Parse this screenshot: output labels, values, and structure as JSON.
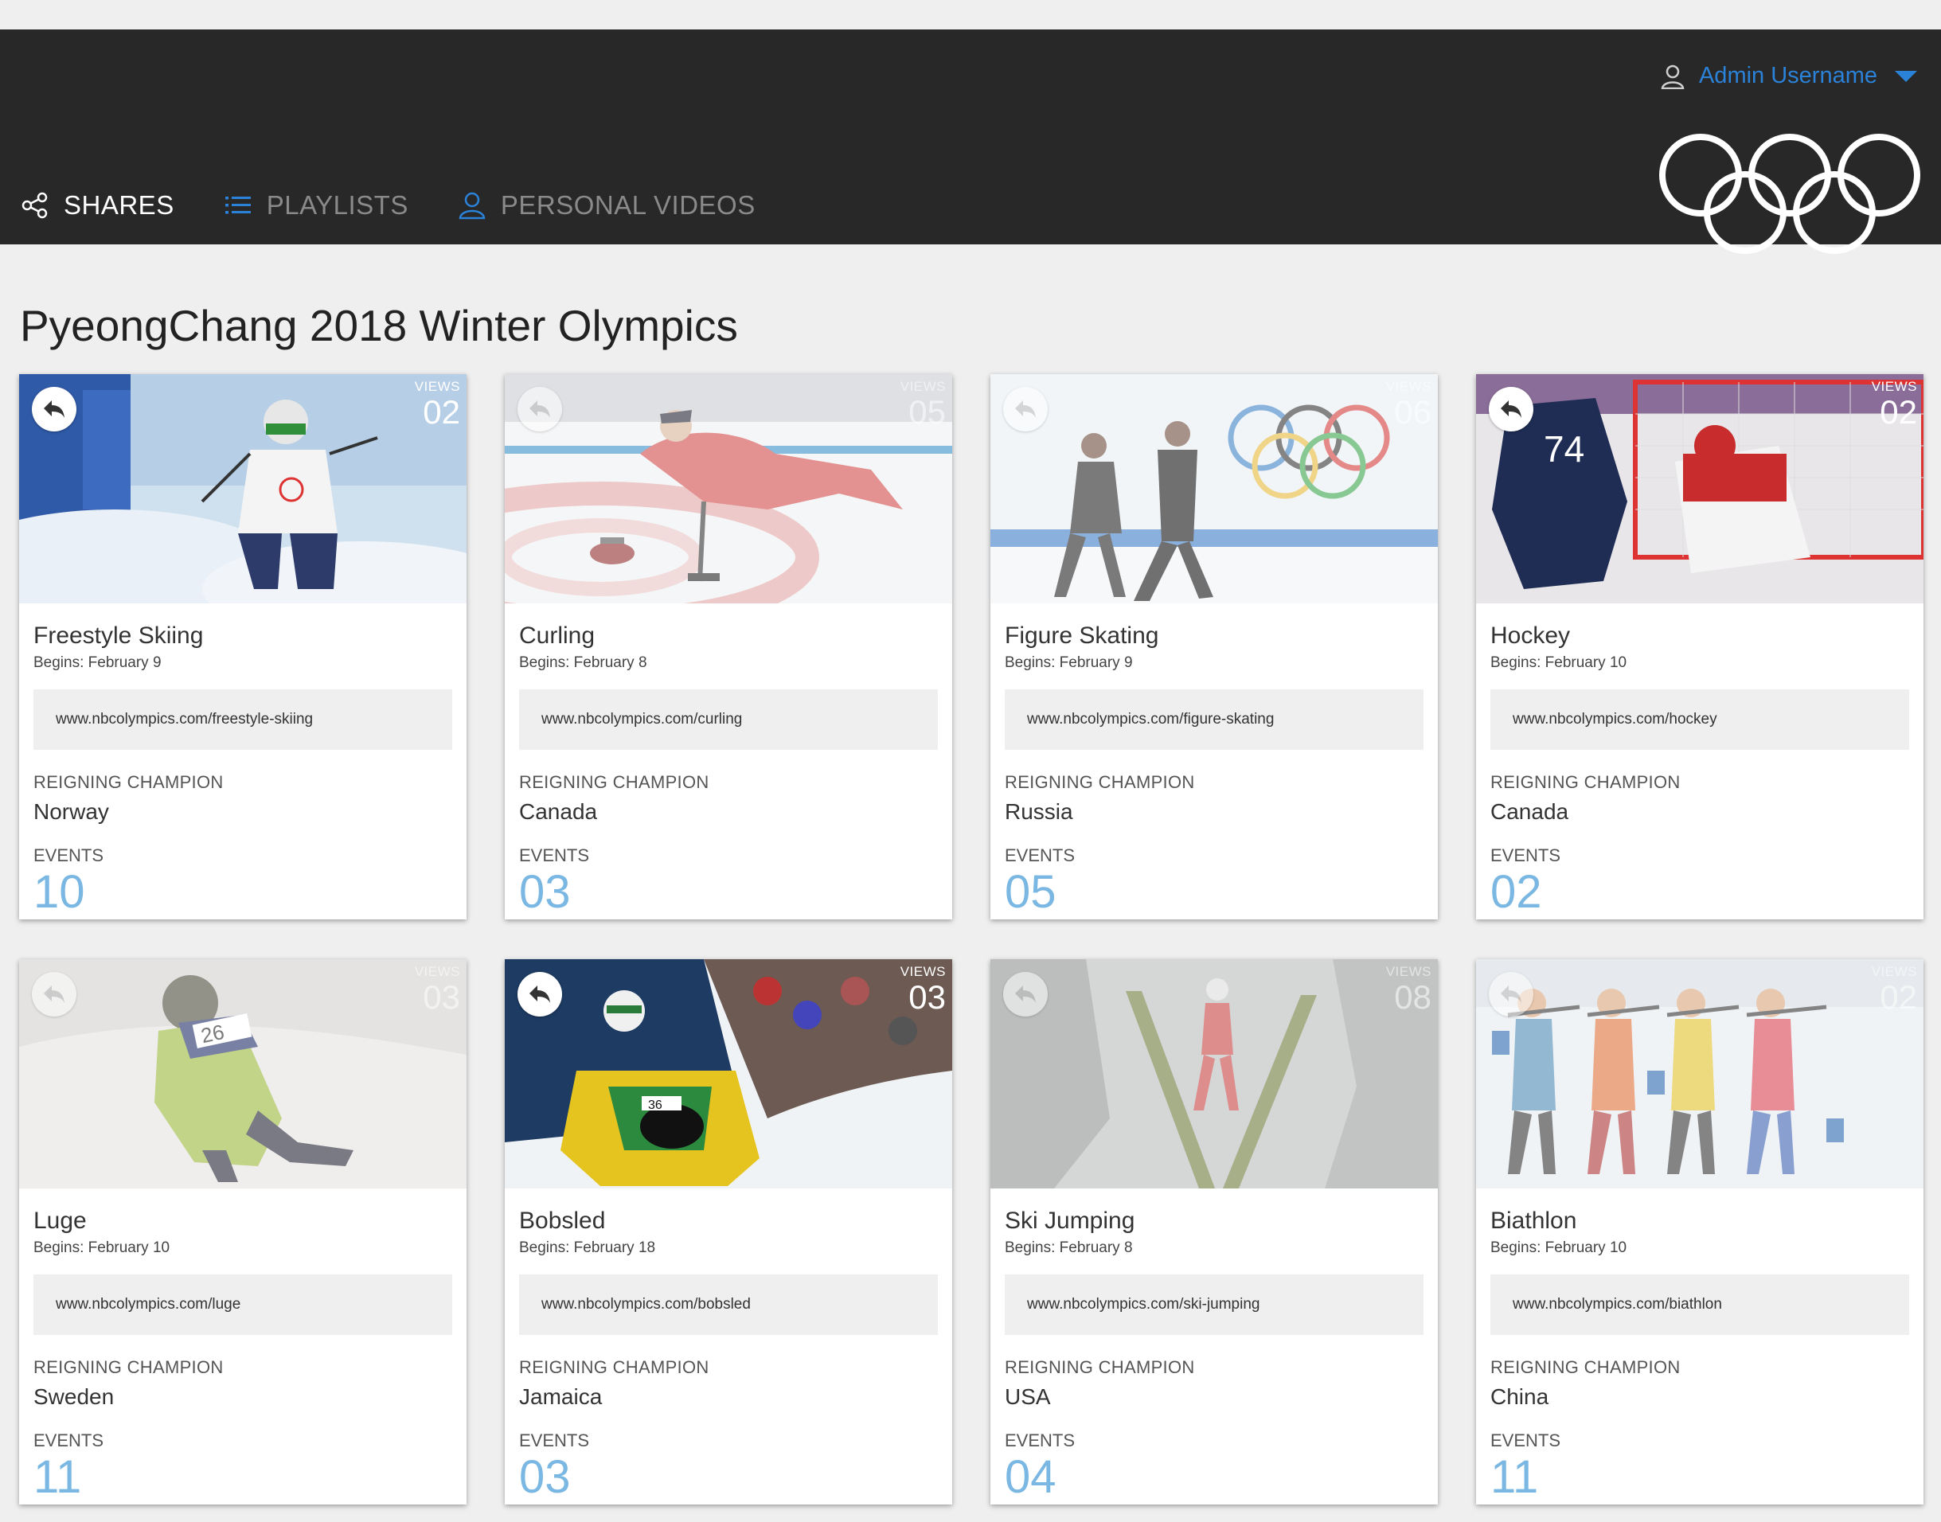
{
  "header": {
    "user_label": "Admin Username",
    "user_icon": "user-icon",
    "nav": [
      {
        "label": "SHARES",
        "icon": "share-icon",
        "active": true
      },
      {
        "label": "PLAYLISTS",
        "icon": "list-icon",
        "active": false
      },
      {
        "label": "PERSONAL VIDEOS",
        "icon": "user-icon",
        "active": false
      }
    ],
    "accent_color": "#2b82d9"
  },
  "page": {
    "title": "PyeongChang 2018 Winter Olympics"
  },
  "labels": {
    "views": "VIEWS",
    "champion": "REIGNING CHAMPION",
    "events": "EVENTS"
  },
  "cards": [
    {
      "sport": "Freestyle Skiing",
      "begins": "Begins: February 9",
      "url": "www.nbcolympics.com/freestyle-skiing",
      "champion": "Norway",
      "events": "10",
      "views": "02"
    },
    {
      "sport": "Curling",
      "begins": "Begins: February 8",
      "url": "www.nbcolympics.com/curling",
      "champion": "Canada",
      "events": "03",
      "views": "05"
    },
    {
      "sport": "Figure Skating",
      "begins": "Begins: February 9",
      "url": "www.nbcolympics.com/figure-skating",
      "champion": "Russia",
      "events": "05",
      "views": "06"
    },
    {
      "sport": "Hockey",
      "begins": "Begins: February 10",
      "url": "www.nbcolympics.com/hockey",
      "champion": "Canada",
      "events": "02",
      "views": "02"
    },
    {
      "sport": "Luge",
      "begins": "Begins: February 10",
      "url": "www.nbcolympics.com/luge",
      "champion": "Sweden",
      "events": "11",
      "views": "03"
    },
    {
      "sport": "Bobsled",
      "begins": "Begins: February 18",
      "url": "www.nbcolympics.com/bobsled",
      "champion": "Jamaica",
      "events": "03",
      "views": "03"
    },
    {
      "sport": "Ski Jumping",
      "begins": "Begins: February 8",
      "url": "www.nbcolympics.com/ski-jumping",
      "champion": "USA",
      "events": "04",
      "views": "08"
    },
    {
      "sport": "Biathlon",
      "begins": "Begins: February 10",
      "url": "www.nbcolympics.com/biathlon",
      "champion": "China",
      "events": "11",
      "views": "02"
    }
  ]
}
